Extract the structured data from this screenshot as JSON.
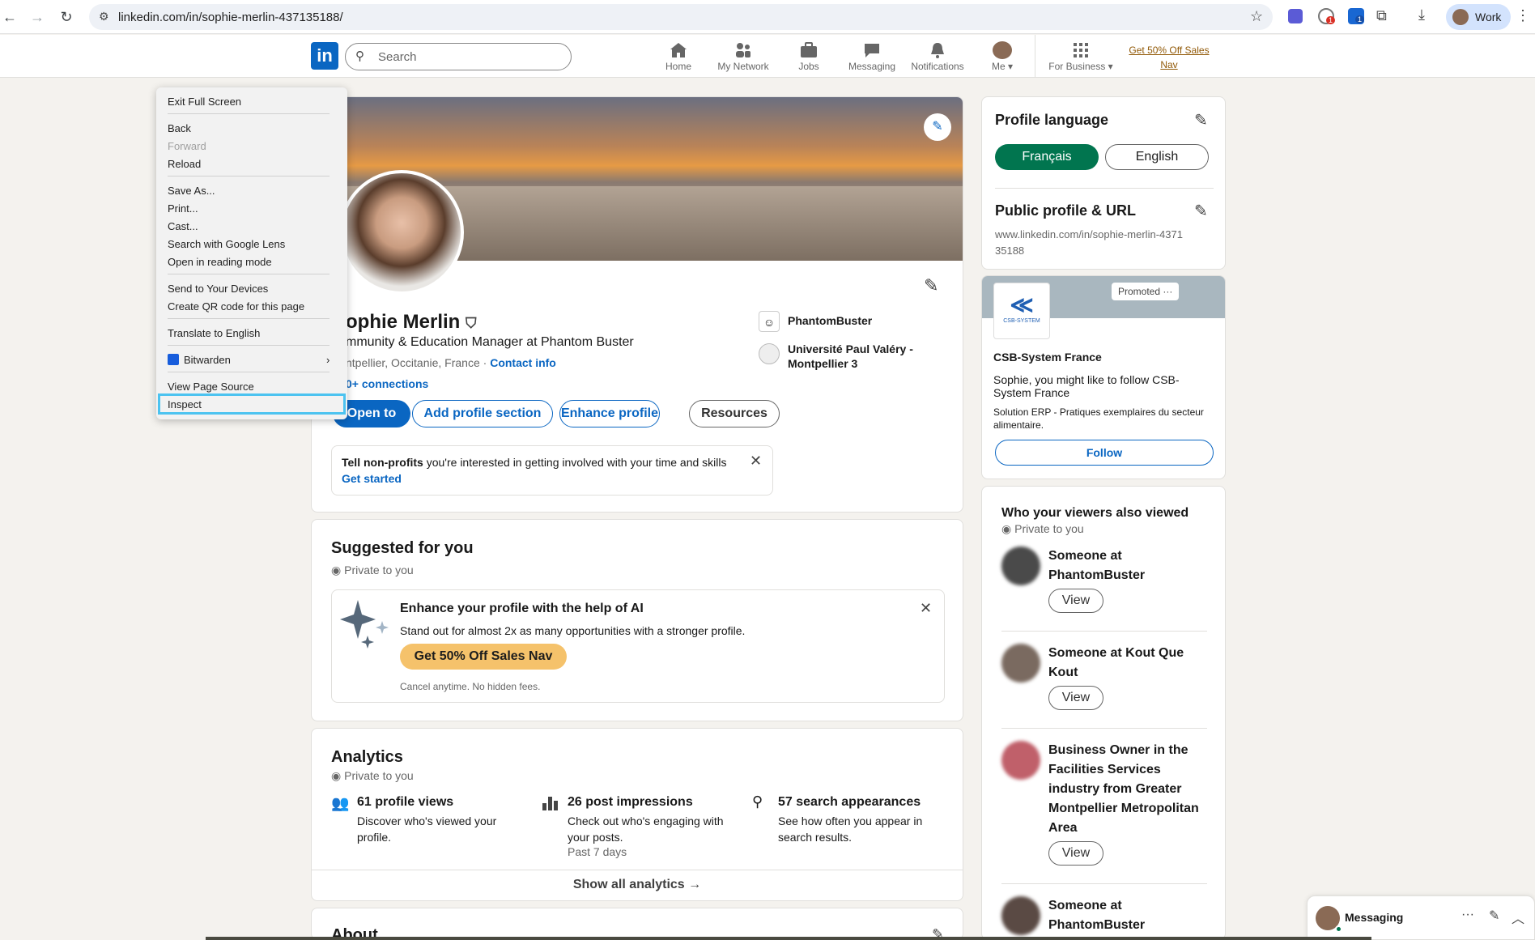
{
  "browser": {
    "url": "linkedin.com/in/sophie-merlin-437135188/",
    "profile_label": "Work",
    "ext_badge_1": "1",
    "ext_badge_2": "1"
  },
  "nav": {
    "search_placeholder": "Search",
    "items": [
      "Home",
      "My Network",
      "Jobs",
      "Messaging",
      "Notifications",
      "Me",
      "For Business"
    ],
    "promo_line1": "Get 50% Off Sales",
    "promo_line2": "Nav"
  },
  "context_menu": {
    "items": [
      "Exit Full Screen",
      "Back",
      "Forward",
      "Reload",
      "Save As...",
      "Print...",
      "Cast...",
      "Search with Google Lens",
      "Open in reading mode",
      "Send to Your Devices",
      "Create QR code for this page",
      "Translate to English",
      "Bitwarden",
      "View Page Source",
      "Inspect"
    ],
    "highlighted": "Inspect"
  },
  "profile": {
    "name": "ophie Merlin",
    "headline": "mmunity & Education Manager at Phantom Buster",
    "location": "ntpellier, Occitanie, France",
    "contact_info": "Contact info",
    "connections": "0+ connections",
    "company": "PhantomBuster",
    "school": "Université Paul Valéry - Montpellier 3",
    "buttons": [
      "Open to",
      "Add profile section",
      "Enhance profile",
      "Resources"
    ],
    "nonprofit_bold": "Tell non-profits",
    "nonprofit_rest": " you're interested in getting involved with your time and skills",
    "get_started": "Get started"
  },
  "suggested": {
    "title": "Suggested for you",
    "private": "Private to you",
    "ai_title": "Enhance your profile with the help of AI",
    "ai_desc": "Stand out for almost 2x as many opportunities with a stronger profile.",
    "ai_button": "Get 50% Off Sales Nav",
    "ai_note": "Cancel anytime. No hidden fees."
  },
  "analytics": {
    "title": "Analytics",
    "private": "Private to you",
    "stats": [
      {
        "title": "61 profile views",
        "desc": "Discover who's viewed your profile.",
        "extra": ""
      },
      {
        "title": "26 post impressions",
        "desc": "Check out who's engaging with your posts.",
        "extra": "Past 7 days"
      },
      {
        "title": "57 search appearances",
        "desc": "See how often you appear in search results.",
        "extra": ""
      }
    ],
    "show_all": "Show all analytics →",
    "about_partial": "About"
  },
  "sidebar": {
    "profile_language": "Profile language",
    "lang_fr": "Français",
    "lang_en": "English",
    "public_profile": "Public profile & URL",
    "public_url": "www.linkedin.com/in/sophie-merlin-437135188",
    "ad": {
      "promoted": "Promoted",
      "company": "CSB-System France",
      "logo_text": "CSB-SYSTEM",
      "text1": "Sophie, you might like to follow CSB-System France",
      "text2": "Solution ERP - Pratiques exemplaires du secteur alimentaire.",
      "follow": "Follow"
    },
    "viewers": {
      "title": "Who your viewers also viewed",
      "private": "Private to you",
      "people": [
        {
          "name": "Someone at PhantomBuster",
          "button": "View"
        },
        {
          "name": "Someone at Kout Que Kout",
          "button": "View"
        },
        {
          "name": "Business Owner in the Facilities Services industry from Greater Montpellier Metropolitan Area",
          "button": "View"
        },
        {
          "name": "Someone at PhantomBuster",
          "button": ""
        }
      ]
    }
  },
  "messaging": {
    "label": "Messaging"
  },
  "colors": {
    "linkedin_blue": "#0a66c2",
    "green": "#01754f",
    "promo_gold": "#f5c26b",
    "highlight": "#4cc3f0"
  }
}
